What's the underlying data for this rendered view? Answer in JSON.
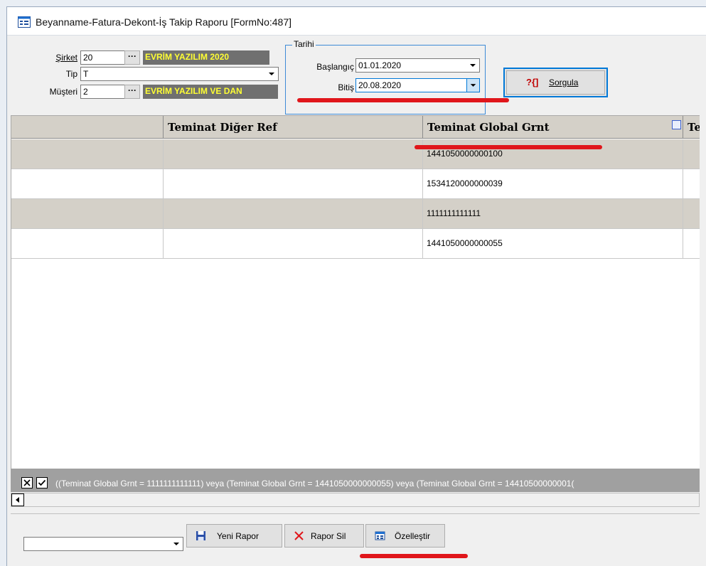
{
  "window": {
    "title": "Beyanname-Fatura-Dekont-İş Takip Raporu [FormNo:487]"
  },
  "filters": {
    "sirket": {
      "label": "Şirket",
      "value": "20",
      "name": "EVRİM YAZILIM  2020"
    },
    "tip": {
      "label": "Tip",
      "value": "T"
    },
    "musteri": {
      "label": "Müşteri",
      "value": "2",
      "name": "EVRİM YAZILIM VE DAN"
    },
    "lookup_btn": "···"
  },
  "date_group": {
    "title": "Tarihi",
    "start_label": "Başlangıç",
    "start_value": "01.01.2020",
    "end_label": "Bitiş",
    "end_value": "20.08.2020"
  },
  "query_button": {
    "icon_text": "?{]",
    "label": "Sorgula"
  },
  "grid": {
    "columns": [
      "",
      "Teminat Diğer Ref",
      "Teminat Global Grnt",
      "Ter"
    ],
    "rows": [
      [
        "",
        "",
        "1441050000000100",
        ""
      ],
      [
        "",
        "",
        "1534120000000039",
        ""
      ],
      [
        "",
        "",
        "1111111111111",
        ""
      ],
      [
        "",
        "",
        "1441050000000055",
        ""
      ]
    ]
  },
  "filter_bar": {
    "text": "((Teminat Global Grnt = 1111111111111) veya (Teminat Global Grnt = 1441050000000055) veya (Teminat Global Grnt = 14410500000001("
  },
  "bottom": {
    "report_select_value": "",
    "new_report": "Yeni Rapor",
    "delete_report": "Rapor Sil",
    "customize": "Özelleştir"
  },
  "colors": {
    "accent": "#0078d7",
    "highlight_line": "#e0161b",
    "row_alt": "#d4d0c8",
    "label_text": "#ffff33"
  }
}
